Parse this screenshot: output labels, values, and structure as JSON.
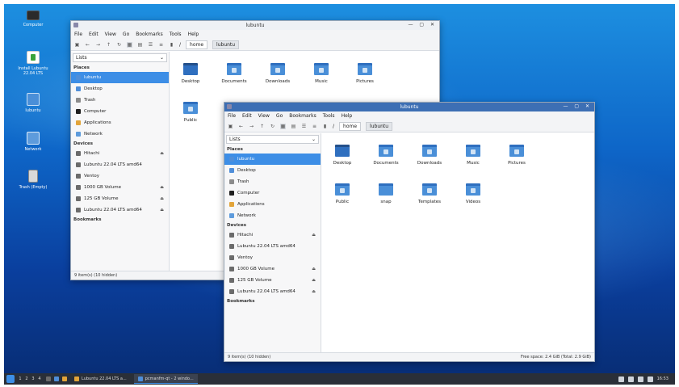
{
  "desktop": {
    "icons": [
      {
        "label": "Computer",
        "icon": "monitor-icon"
      },
      {
        "label": "Install Lubuntu 22.04 LTS",
        "icon": "installer-icon"
      },
      {
        "label": "lubuntu",
        "icon": "home-folder-icon"
      },
      {
        "label": "Network",
        "icon": "network-icon"
      },
      {
        "label": "Trash (Empty)",
        "icon": "trash-icon"
      }
    ]
  },
  "window_back": {
    "title": "lubuntu",
    "controls": "— ▢ ✕",
    "menu": [
      "File",
      "Edit",
      "View",
      "Go",
      "Bookmarks",
      "Tools",
      "Help"
    ],
    "crumbs": [
      "/",
      "home",
      "lubuntu"
    ],
    "view_select": "Lists",
    "places_label": "Places",
    "places": [
      "lubuntu",
      "Desktop",
      "Trash",
      "Computer",
      "Applications",
      "Network"
    ],
    "devices_label": "Devices",
    "devices": [
      "Hitachi",
      "Lubuntu 22.04 LTS amd64",
      "Ventoy",
      "1000 GB Volume",
      "125 GB Volume",
      "Lubuntu 22.04 LTS amd64"
    ],
    "bookmarks_label": "Bookmarks",
    "files": [
      "Desktop",
      "Documents",
      "Downloads",
      "Music",
      "Pictures",
      "Public"
    ],
    "status_left": "9 item(s) (10 hidden)"
  },
  "window_front": {
    "title": "lubuntu",
    "controls": "— ▢ ✕",
    "menu": [
      "File",
      "Edit",
      "View",
      "Go",
      "Bookmarks",
      "Tools",
      "Help"
    ],
    "crumbs": [
      "/",
      "home",
      "lubuntu"
    ],
    "view_select": "Lists",
    "places_label": "Places",
    "places": [
      "lubuntu",
      "Desktop",
      "Trash",
      "Computer",
      "Applications",
      "Network"
    ],
    "devices_label": "Devices",
    "devices": [
      "Hitachi",
      "Lubuntu 22.04 LTS amd64",
      "Ventoy",
      "1000 GB Volume",
      "125 GB Volume",
      "Lubuntu 22.04 LTS amd64"
    ],
    "bookmarks_label": "Bookmarks",
    "files": [
      "Desktop",
      "Documents",
      "Downloads",
      "Music",
      "Pictures",
      "Public",
      "snap",
      "Templates",
      "Videos"
    ],
    "status_left": "9 item(s) (10 hidden)",
    "status_right": "Free space: 2.4 GiB (Total: 2.9 GiB)"
  },
  "taskbar": {
    "workspaces": [
      "1",
      "2",
      "3",
      "4"
    ],
    "tasks": [
      "Lubuntu 22.04 LTS a...",
      "pcmanfm-qt - 2 windo..."
    ],
    "clock": "16:53"
  },
  "colors": {
    "accent": "#3d8ee6",
    "titlebar_active": "#3d6fb4",
    "folder": "#4a8fd8"
  }
}
